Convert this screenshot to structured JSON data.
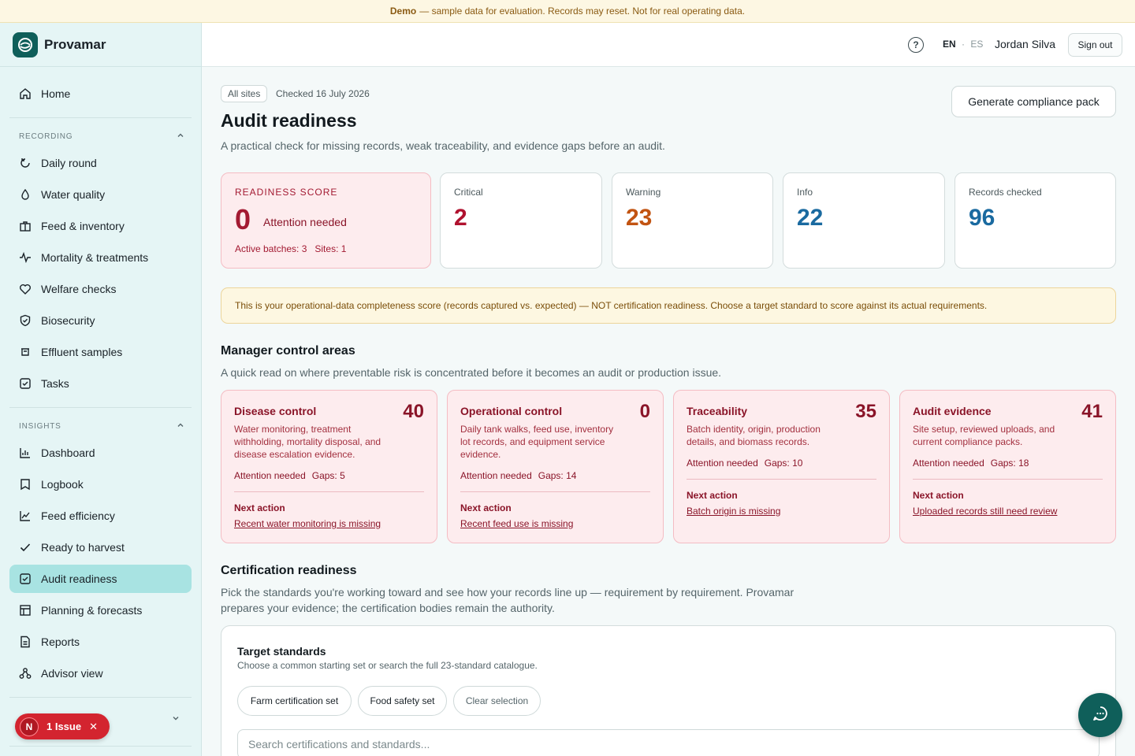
{
  "banner": {
    "label": "Demo",
    "text": "— sample data for evaluation. Records may reset. Not for real operating data."
  },
  "brand": {
    "name": "Provamar"
  },
  "nav": {
    "home": "Home",
    "recording_label": "RECORDING",
    "recording": [
      {
        "label": "Daily round",
        "icon": "refresh-icon"
      },
      {
        "label": "Water quality",
        "icon": "droplet-icon"
      },
      {
        "label": "Feed & inventory",
        "icon": "box-icon"
      },
      {
        "label": "Mortality & treatments",
        "icon": "pulse-icon"
      },
      {
        "label": "Welfare checks",
        "icon": "heart-icon"
      },
      {
        "label": "Biosecurity",
        "icon": "shield-icon"
      },
      {
        "label": "Effluent samples",
        "icon": "flask-icon"
      },
      {
        "label": "Tasks",
        "icon": "checkbox-icon"
      }
    ],
    "insights_label": "INSIGHTS",
    "insights": [
      {
        "label": "Dashboard",
        "icon": "bar-chart-icon"
      },
      {
        "label": "Logbook",
        "icon": "book-icon"
      },
      {
        "label": "Feed efficiency",
        "icon": "line-chart-icon"
      },
      {
        "label": "Ready to harvest",
        "icon": "check-icon"
      },
      {
        "label": "Audit readiness",
        "icon": "checkbox-icon",
        "active": true
      },
      {
        "label": "Planning & forecasts",
        "icon": "table-icon"
      },
      {
        "label": "Reports",
        "icon": "document-icon"
      },
      {
        "label": "Advisor view",
        "icon": "network-icon"
      }
    ]
  },
  "issue": {
    "n": "N",
    "label": "1 Issue",
    "close": "✕"
  },
  "topbar": {
    "help": "?",
    "lang_en": "EN",
    "lang_sep": "·",
    "lang_es": "ES",
    "user": "Jordan Silva",
    "signout": "Sign out"
  },
  "page": {
    "tag": "All sites",
    "checked": "Checked 16 July 2026",
    "title": "Audit readiness",
    "subtitle": "A practical check for missing records, weak traceability, and evidence gaps before an audit.",
    "generate_button": "Generate compliance pack"
  },
  "score": {
    "label": "READINESS SCORE",
    "value": "0",
    "status": "Attention needed",
    "meta": "Active batches: 3   Sites: 1"
  },
  "stats": [
    {
      "label": "Critical",
      "value": "2",
      "color": "#b0122f"
    },
    {
      "label": "Warning",
      "value": "23",
      "color": "#c25412"
    },
    {
      "label": "Info",
      "value": "22",
      "color": "#1a6aa0"
    },
    {
      "label": "Records checked",
      "value": "96",
      "color": "#1a6aa0"
    }
  ],
  "note": "This is your operational-data completeness score (records captured vs. expected) — NOT certification readiness. Choose a target standard to score against its actual requirements.",
  "manager": {
    "title": "Manager control areas",
    "subtitle": "A quick read on where preventable risk is concentrated before it becomes an audit or production issue.",
    "areas": [
      {
        "title": "Disease control",
        "value": "40",
        "desc": "Water monitoring, treatment withholding, mortality disposal, and disease escalation evidence.",
        "status": "Attention needed",
        "gaps": "Gaps: 5",
        "next_label": "Next action",
        "next_link": "Recent water monitoring is missing"
      },
      {
        "title": "Operational control",
        "value": "0",
        "desc": "Daily tank walks, feed use, inventory lot records, and equipment service evidence.",
        "status": "Attention needed",
        "gaps": "Gaps: 14",
        "next_label": "Next action",
        "next_link": "Recent feed use is missing"
      },
      {
        "title": "Traceability",
        "value": "35",
        "desc": "Batch identity, origin, production details, and biomass records.",
        "status": "Attention needed",
        "gaps": "Gaps: 10",
        "next_label": "Next action",
        "next_link": "Batch origin is missing"
      },
      {
        "title": "Audit evidence",
        "value": "41",
        "desc": "Site setup, reviewed uploads, and current compliance packs.",
        "status": "Attention needed",
        "gaps": "Gaps: 18",
        "next_label": "Next action",
        "next_link": "Uploaded records still need review"
      }
    ]
  },
  "cert": {
    "title": "Certification readiness",
    "subtitle": "Pick the standards you're working toward and see how your records line up — requirement by requirement. Provamar prepares your evidence; the certification bodies remain the authority."
  },
  "standards": {
    "title": "Target standards",
    "subtitle": "Choose a common starting set or search the full 23-standard catalogue.",
    "chip_farm": "Farm certification set",
    "chip_food": "Food safety set",
    "chip_clear": "Clear selection",
    "search_placeholder": "Search certifications and standards..."
  }
}
